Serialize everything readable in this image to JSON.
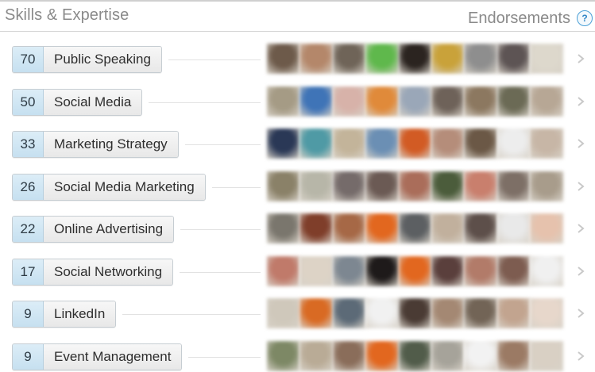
{
  "header": {
    "title": "Skills & Expertise",
    "endorsements_label": "Endorsements",
    "help_symbol": "?"
  },
  "skills": [
    {
      "count": "70",
      "name": "Public Speaking",
      "avatars": [
        "#6d5a4a",
        "#b4876a",
        "#6f6458",
        "#5fb84c",
        "#2b2420",
        "#c9a23a",
        "#8e8e8e",
        "#5d5454",
        "#ddd8cc"
      ]
    },
    {
      "count": "50",
      "name": "Social Media",
      "avatars": [
        "#a59b85",
        "#3f74b7",
        "#d7b2a9",
        "#e08a3a",
        "#9aa7b8",
        "#6e6259",
        "#8c7860",
        "#6b6a55",
        "#b7a795"
      ]
    },
    {
      "count": "33",
      "name": "Marketing Strategy",
      "avatars": [
        "#2a3856",
        "#4f9aa5",
        "#c3b49a",
        "#6b8fb4",
        "#d25b24",
        "#b58d7a",
        "#6b5846",
        "#ededed",
        "#c7b6a6"
      ]
    },
    {
      "count": "26",
      "name": "Social Media Marketing",
      "avatars": [
        "#8a8168",
        "#b7b6a8",
        "#756b6a",
        "#6b5a54",
        "#aa6d5a",
        "#4b5c3b",
        "#c97f6d",
        "#7d6f66",
        "#a89c8b"
      ]
    },
    {
      "count": "22",
      "name": "Online Advertising",
      "avatars": [
        "#7a766d",
        "#7f3e2a",
        "#a66846",
        "#e2671f",
        "#5c5f62",
        "#c1b09d",
        "#5d4f4a",
        "#e9e9e9",
        "#e6c2ad"
      ]
    },
    {
      "count": "17",
      "name": "Social Networking",
      "avatars": [
        "#c07a6a",
        "#ddd3c6",
        "#7d8791",
        "#1e1a1a",
        "#e2671f",
        "#5a3f3c",
        "#b27b69",
        "#7d5c50",
        "#f0f0f0"
      ]
    },
    {
      "count": "9",
      "name": "LinkedIn",
      "avatars": [
        "#cfc8bb",
        "#d96a23",
        "#5c6a77",
        "#f1f1f1",
        "#4a3b34",
        "#a48873",
        "#726456",
        "#c2a48f",
        "#e7d7cb"
      ]
    },
    {
      "count": "9",
      "name": "Event Management",
      "avatars": [
        "#7d8865",
        "#b9ab96",
        "#8a6d5a",
        "#e2671f",
        "#515c4a",
        "#a6a39a",
        "#f2f2f2",
        "#9b7a64",
        "#d9d0c4"
      ]
    }
  ],
  "icons": {
    "help": "question-circle-icon",
    "row_action": "chevron-right-icon"
  },
  "colors": {
    "header_text": "#8a8a8a",
    "count_bg": "#c6e0f0",
    "pill_bg": "#efefef",
    "help_blue": "#2f86c6"
  }
}
